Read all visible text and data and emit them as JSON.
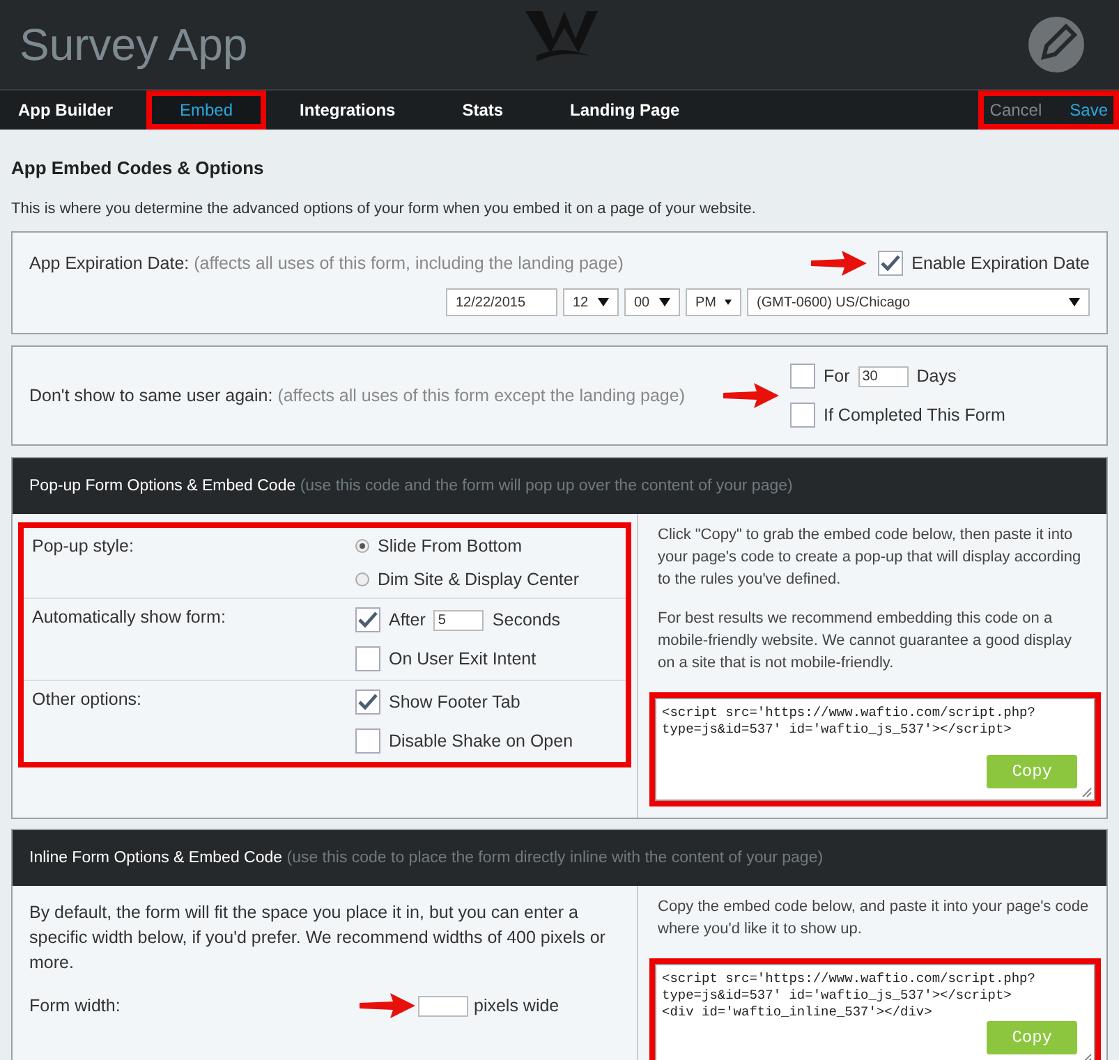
{
  "header": {
    "title": "Survey App"
  },
  "nav": {
    "tabs": [
      {
        "label": "App Builder",
        "selected": false,
        "highlighted": false
      },
      {
        "label": "Embed",
        "selected": true,
        "highlighted": true
      },
      {
        "label": "Integrations",
        "selected": false,
        "highlighted": false
      },
      {
        "label": "Stats",
        "selected": false,
        "highlighted": false
      },
      {
        "label": "Landing Page",
        "selected": false,
        "highlighted": false
      }
    ],
    "actions_highlighted": true,
    "actions": [
      {
        "label": "Cancel",
        "kind": "secondary"
      },
      {
        "label": "Save",
        "kind": "primary"
      }
    ]
  },
  "page": {
    "heading": "App Embed Codes & Options",
    "description": "This is where you determine the advanced options of your form when you embed it on a page of your website."
  },
  "expiration": {
    "label": "App Expiration Date:",
    "note": "(affects all uses of this form, including the landing page)",
    "enable": {
      "label": "Enable Expiration Date",
      "checked": true,
      "pointer_arrow": true
    },
    "date": "12/22/2015",
    "hour": "12",
    "minute": "00",
    "ampm": "PM",
    "timezone": "(GMT-0600) US/Chicago"
  },
  "repeat": {
    "label": "Don't show to same user again:",
    "note": "(affects all uses of this form except the landing page)",
    "pointer_arrow": true,
    "options": [
      {
        "kind": "number",
        "checked": false,
        "prefix": "For",
        "value": "30",
        "suffix": "Days"
      },
      {
        "kind": "plain",
        "checked": false,
        "label": "If Completed This Form"
      }
    ]
  },
  "popup": {
    "title": "Pop-up Form Options & Embed Code",
    "note": "(use this code and the form will pop up over the content of your page)",
    "options_highlighted": true,
    "rows": [
      {
        "label": "Pop-up style:",
        "controls": [
          {
            "kind": "radio",
            "selected": true,
            "label": "Slide From Bottom"
          },
          {
            "kind": "radio",
            "selected": false,
            "label": "Dim Site & Display Center"
          }
        ]
      },
      {
        "label": "Automatically show form:",
        "controls": [
          {
            "kind": "number",
            "checked": true,
            "prefix": "After",
            "value": "5",
            "suffix": "Seconds"
          },
          {
            "kind": "plain",
            "checked": false,
            "label": "On User Exit Intent"
          }
        ]
      },
      {
        "label": "Other options:",
        "controls": [
          {
            "kind": "plain",
            "checked": true,
            "label": "Show Footer Tab"
          },
          {
            "kind": "plain",
            "checked": false,
            "label": "Disable Shake on Open"
          }
        ]
      }
    ],
    "help": [
      "Click \"Copy\" to grab the embed code below, then paste it into your page's code to create a pop-up that will display according to the rules you've defined.",
      "For best results we recommend embedding this code on a mobile-friendly website. We cannot guarantee a good display on a site that is not mobile-friendly."
    ],
    "code": "<script src='https://www.waftio.com/script.php?type=js&id=537' id='waftio_js_537'></script>",
    "code_highlighted": true,
    "copy_label": "Copy"
  },
  "inline": {
    "title": "Inline Form Options & Embed Code",
    "note": "(use this code to place the form directly inline with the content of your page)",
    "help": "By default, the form will fit the space you place it in, but you can enter a specific width below, if you'd prefer. We recommend widths of 400 pixels or more.",
    "width_label": "Form width:",
    "width_suffix": "pixels wide",
    "pointer_arrow": true,
    "copy_help": "Copy the embed code below, and paste it into your page's code where you'd like it to show up.",
    "code": "<script src='https://www.waftio.com/script.php?type=js&id=537' id='waftio_js_537'></script>\n<div id='waftio_inline_537'></div>",
    "code_highlighted": true,
    "copy_label": "Copy"
  }
}
